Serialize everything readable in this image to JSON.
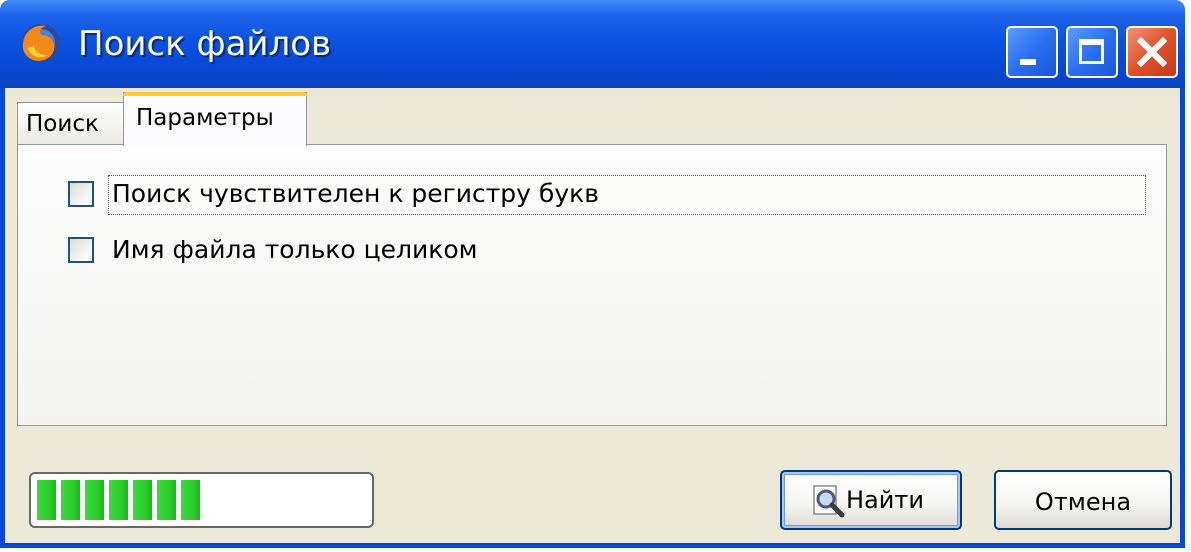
{
  "window": {
    "title": "Поиск файлов",
    "app_icon": "firefox-icon",
    "controls": {
      "minimize_icon": "minimize-icon",
      "maximize_icon": "maximize-icon",
      "close_icon": "close-icon"
    }
  },
  "tabs": [
    {
      "label": "Поиск",
      "selected": false
    },
    {
      "label": "Параметры",
      "selected": true
    }
  ],
  "options": [
    {
      "label": "Поиск чувствителен к регистру букв",
      "checked": false,
      "focused": true
    },
    {
      "label": "Имя файла только целиком",
      "checked": false,
      "focused": false
    }
  ],
  "progress": {
    "fraction": 0.48
  },
  "buttons": {
    "find_label": "Найти",
    "find_icon": "magnifier-icon",
    "cancel_label": "Отмена"
  },
  "colors": {
    "titlebar": "#0a52e0",
    "close_button": "#e0522c",
    "tab_highlight": "#ffc83c",
    "progress": "#2ccc2c",
    "dialog_background": "#ece9d8"
  }
}
